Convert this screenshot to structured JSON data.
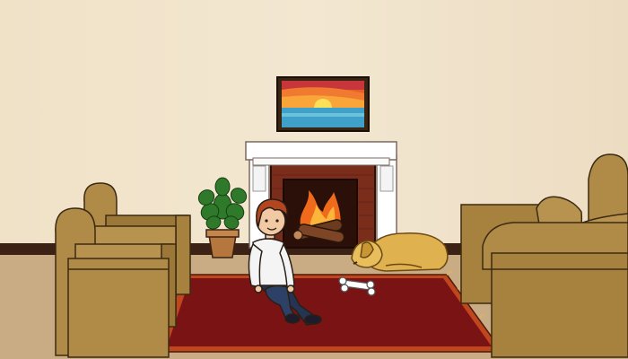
{
  "scene": {
    "type": "living-room",
    "colors": {
      "wall": "#efe2c9",
      "floor": "#c9ab84",
      "baseboard": "#3b2215",
      "rug": "#7a1414",
      "rug_border": "#c0461e",
      "sofa": "#b08a47",
      "fireplace_mantel": "#ffffff",
      "fireplace_brick": "#7b2d1c",
      "dog": "#e0b14f",
      "boy_hair": "#b3461e",
      "boy_shirt": "#f4f4f4",
      "boy_pants": "#243553"
    },
    "objects": [
      "painting-sunset",
      "fireplace",
      "potted-plant",
      "armchair-left",
      "sofa-right",
      "boy",
      "dog-sleeping",
      "bone",
      "rug"
    ]
  }
}
